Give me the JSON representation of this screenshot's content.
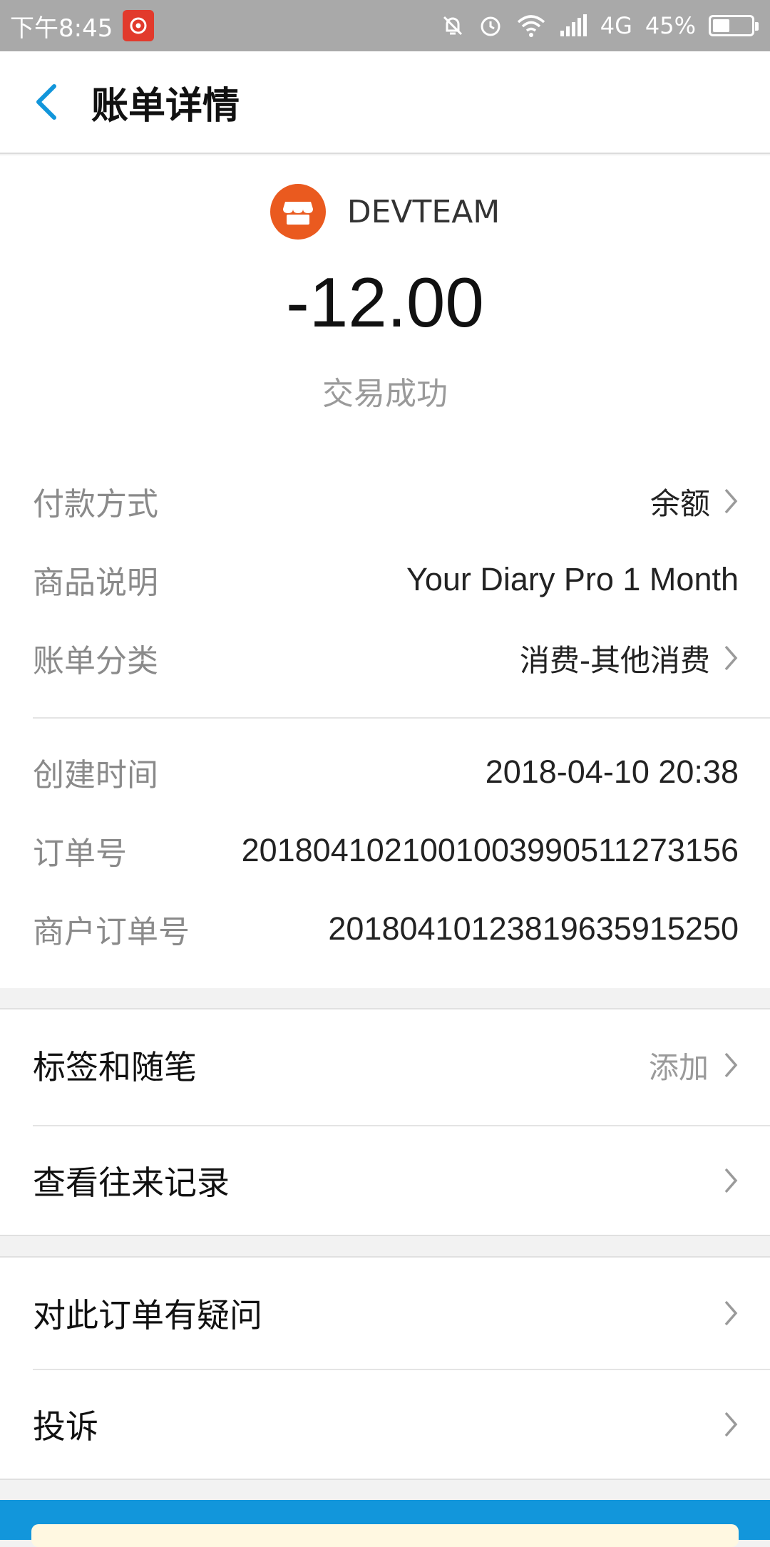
{
  "status_bar": {
    "time": "下午8:45",
    "network": "4G",
    "battery": "45%",
    "battery_level": 0.45,
    "icons": [
      "notification-muted-icon",
      "alarm-icon",
      "wifi-icon",
      "signal-icon"
    ]
  },
  "header": {
    "title": "账单详情"
  },
  "summary": {
    "merchant": "DEVTEAM",
    "amount": "-12.00",
    "status": "交易成功"
  },
  "details": [
    {
      "label": "付款方式",
      "value": "余额",
      "has_arrow": true
    },
    {
      "label": "商品说明",
      "value": "Your Diary Pro 1 Month",
      "has_arrow": false
    },
    {
      "label": "账单分类",
      "value": "消费-其他消费",
      "has_arrow": true
    },
    {
      "label": "创建时间",
      "value": "2018-04-10 20:38",
      "has_arrow": false
    },
    {
      "label": "订单号",
      "value": "2018041021001003990511273156",
      "has_arrow": false
    },
    {
      "label": "商户订单号",
      "value": "20180410123819635915250",
      "has_arrow": false
    }
  ],
  "group1": [
    {
      "label": "标签和随笔",
      "extra": "添加"
    },
    {
      "label": "查看往来记录",
      "extra": ""
    }
  ],
  "group2": [
    {
      "label": "对此订单有疑问",
      "extra": ""
    },
    {
      "label": "投诉",
      "extra": ""
    }
  ],
  "colors": {
    "accent": "#1296db",
    "merchant_logo": "#ea5a1f",
    "status_bar": "#a9a9a9"
  }
}
